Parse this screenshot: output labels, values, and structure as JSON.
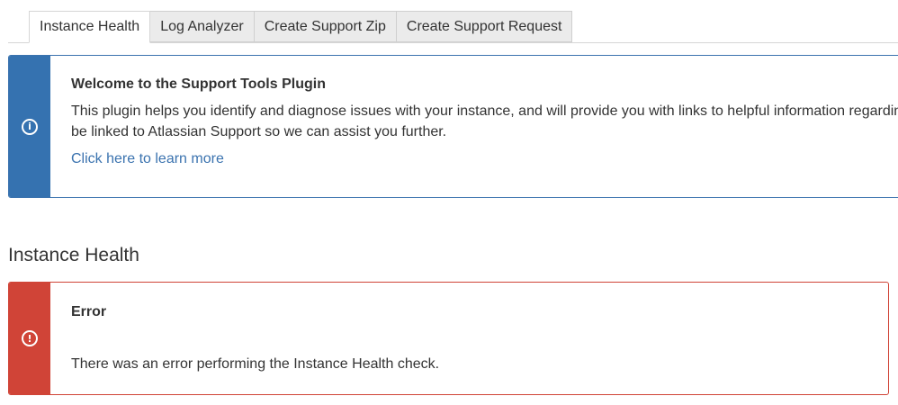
{
  "tabs": [
    {
      "label": "Instance Health",
      "active": true
    },
    {
      "label": "Log Analyzer",
      "active": false
    },
    {
      "label": "Create Support Zip",
      "active": false
    },
    {
      "label": "Create Support Request",
      "active": false
    }
  ],
  "info_message": {
    "icon": "info-icon",
    "title": "Welcome to the Support Tools Plugin",
    "line1": "This plugin helps you identify and diagnose issues with your instance, and will provide you with links to helpful information regarding",
    "line2": "be linked to Atlassian Support so we can assist you further.",
    "link": "Click here to learn more",
    "accent_color": "#3572b0"
  },
  "section": {
    "heading": "Instance Health"
  },
  "error_message": {
    "icon": "error-icon",
    "title": "Error",
    "text": "There was an error performing the Instance Health check.",
    "accent_color": "#d04437"
  }
}
